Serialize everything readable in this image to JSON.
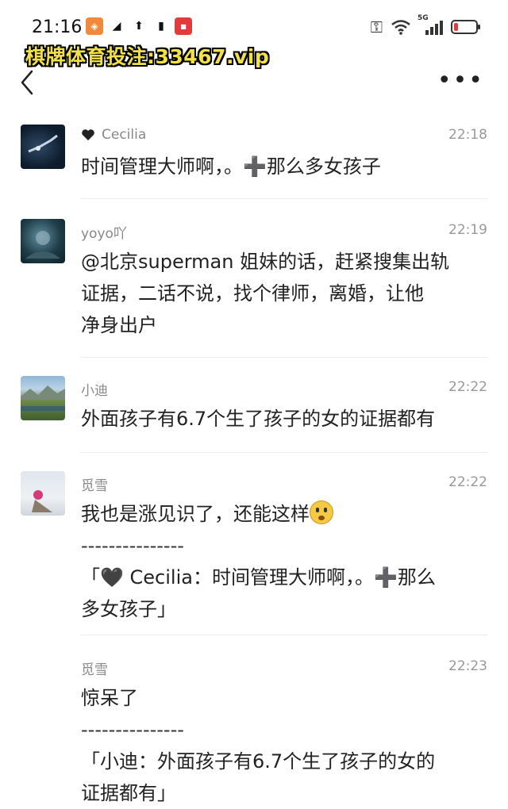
{
  "status": {
    "time": "21:16",
    "network_label": "5G"
  },
  "watermark": "棋牌体育投注:33467.vip",
  "header": {
    "back_icon": "chevron-left-icon",
    "more_icon": "more-dots-icon"
  },
  "comments": [
    {
      "name": "Cecilia",
      "has_heart": true,
      "time": "22:18",
      "lines": [
        "时间管理大师啊，。➕那么多女孩子"
      ]
    },
    {
      "name": "yoyo吖",
      "has_heart": false,
      "time": "22:19",
      "lines": [
        "@北京superman 姐妹的话，赶紧搜集出轨",
        "证据，二话不说，找个律师，离婚，让他",
        "净身出户"
      ]
    },
    {
      "name": "小迪",
      "has_heart": false,
      "time": "22:22",
      "lines": [
        "外面孩子有6.7个生了孩子的女的证据都有"
      ]
    },
    {
      "name": "觅雪",
      "has_heart": false,
      "time": "22:22",
      "lines": [
        "我也是涨见识了，还能这样",
        "---------------",
        "「🖤 Cecilia：时间管理大师啊，。➕那么",
        "多女孩子」"
      ]
    },
    {
      "name": "觅雪",
      "has_heart": false,
      "time": "22:23",
      "lines": [
        "惊呆了",
        "---------------",
        "「小迪：外面孩子有6.7个生了孩子的女的",
        "证据都有」"
      ]
    }
  ]
}
